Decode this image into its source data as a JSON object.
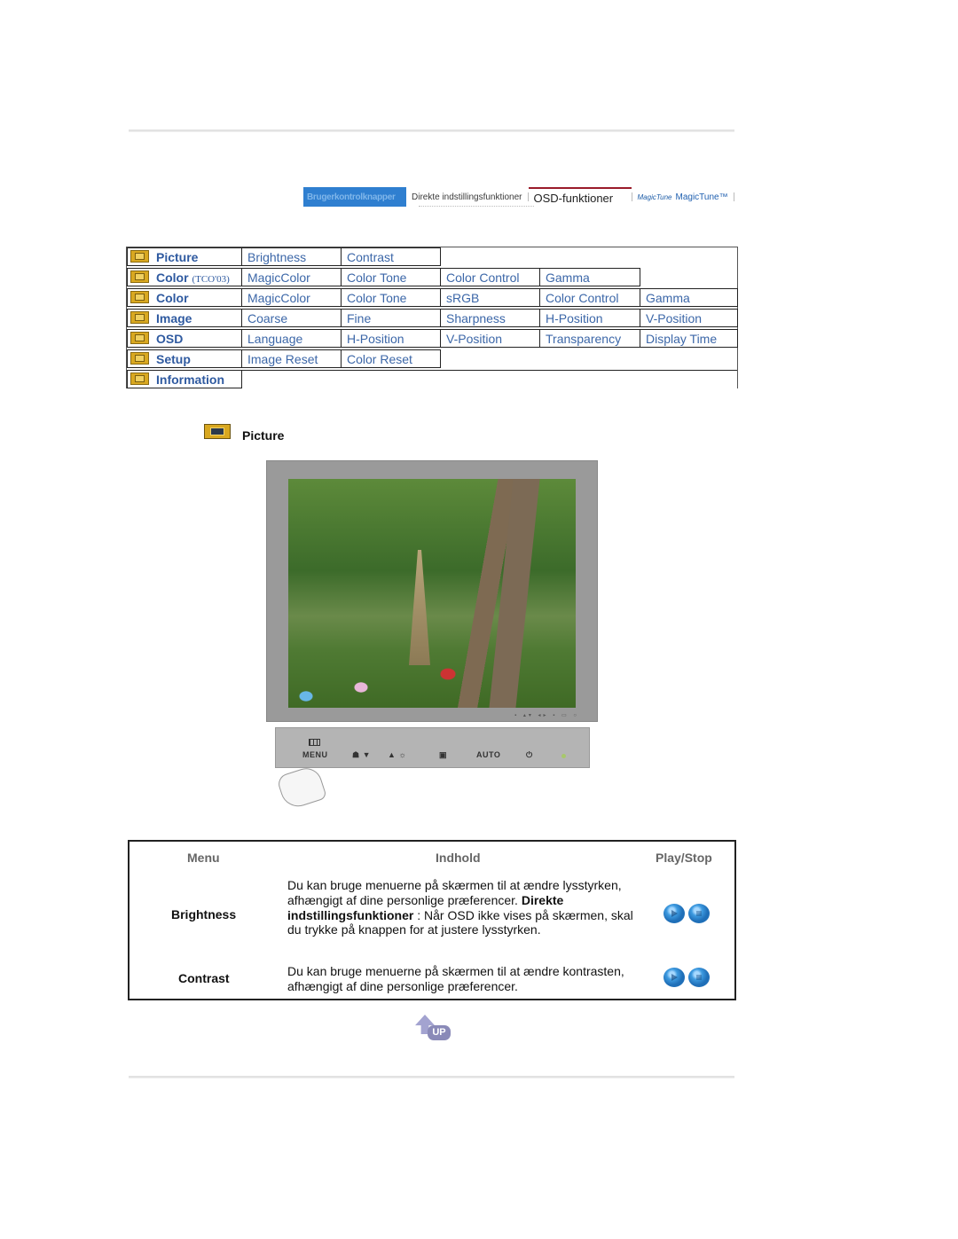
{
  "nav": {
    "tabs": [
      {
        "label": "Brugerkontrolknapper",
        "active": true
      },
      {
        "label": "Direkte indstillingsfunktioner"
      },
      {
        "label": "OSD-funktioner",
        "current": true
      },
      {
        "label": "MagicTune™",
        "logo": "MagicTune"
      }
    ],
    "accent": "#2f7fd0",
    "current_marker": "#9a1b2a"
  },
  "osd_menu": {
    "rows": [
      {
        "menu": "Picture",
        "suffix": "",
        "items": [
          "Brightness",
          "Contrast"
        ]
      },
      {
        "menu": "Color",
        "suffix": "(TCO'03)",
        "items": [
          "MagicColor",
          "Color Tone",
          "Color Control",
          "Gamma"
        ]
      },
      {
        "menu": "Color",
        "suffix": "",
        "items": [
          "MagicColor",
          "Color Tone",
          "sRGB",
          "Color Control",
          "Gamma"
        ]
      },
      {
        "menu": "Image",
        "suffix": "",
        "items": [
          "Coarse",
          "Fine",
          "Sharpness",
          "H-Position",
          "V-Position"
        ]
      },
      {
        "menu": "OSD",
        "suffix": "",
        "items": [
          "Language",
          "H-Position",
          "V-Position",
          "Transparency",
          "Display Time"
        ]
      },
      {
        "menu": "Setup",
        "suffix": "",
        "items": [
          "Image Reset",
          "Color Reset"
        ]
      },
      {
        "menu": "Information",
        "suffix": "",
        "items": []
      }
    ],
    "link_color": "#3c67a8"
  },
  "section": {
    "title": "Picture",
    "icon": "picture-icon"
  },
  "monitor_panel": {
    "buttons": [
      "MENU",
      "AUTO"
    ]
  },
  "description_table": {
    "headers": {
      "menu": "Menu",
      "content": "Indhold",
      "play": "Play/Stop"
    },
    "rows": [
      {
        "name": "Brightness",
        "text1": "Du kan bruge menuerne på skærmen til at ændre lysstyrken, afhængigt af dine personlige præferencer.",
        "bold": "Direkte indstillingsfunktioner",
        "text2": " : Når OSD ikke vises på skærmen, skal du trykke på knappen for at justere lysstyrken."
      },
      {
        "name": "Contrast",
        "text1": "Du kan bruge menuerne på skærmen til at ændre kontrasten, afhængigt af dine personlige præferencer.",
        "bold": "",
        "text2": ""
      }
    ]
  },
  "up_button": {
    "label": "UP"
  }
}
